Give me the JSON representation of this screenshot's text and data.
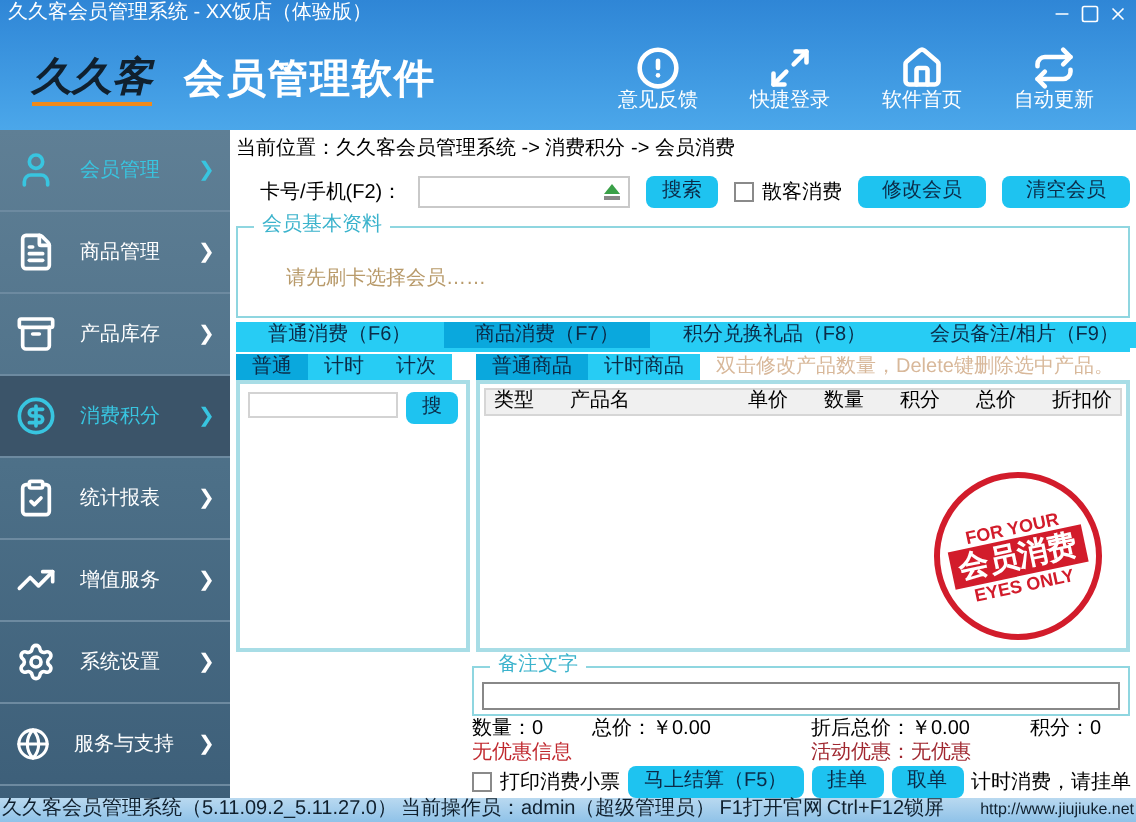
{
  "window": {
    "title": "久久客会员管理系统 - XX饭店（体验版）"
  },
  "header": {
    "logo": "久久客",
    "app_name": "会员管理软件",
    "actions": [
      {
        "kind": "feedback",
        "label": "意见反馈"
      },
      {
        "kind": "switch",
        "label": "快捷登录"
      },
      {
        "kind": "home",
        "label": "软件首页"
      },
      {
        "kind": "update",
        "label": "自动更新"
      }
    ]
  },
  "sidebar": {
    "items": [
      {
        "kind": "member",
        "label": "会员管理",
        "selected": false,
        "highlighted": true
      },
      {
        "kind": "goods",
        "label": "商品管理",
        "selected": false,
        "highlighted": false
      },
      {
        "kind": "stock",
        "label": "产品库存",
        "selected": false,
        "highlighted": false
      },
      {
        "kind": "money",
        "label": "消费积分",
        "selected": true,
        "highlighted": true
      },
      {
        "kind": "report",
        "label": "统计报表",
        "selected": false,
        "highlighted": false
      },
      {
        "kind": "chart",
        "label": "增值服务",
        "selected": false,
        "highlighted": false
      },
      {
        "kind": "settings",
        "label": "系统设置",
        "selected": false,
        "highlighted": false
      },
      {
        "kind": "globe",
        "label": "服务与支持",
        "selected": false,
        "highlighted": false
      }
    ],
    "chevron": "❯"
  },
  "breadcrumb": "当前位置：久久客会员管理系统 -> 消费积分 -> 会员消费",
  "card_search": {
    "label": "卡号/手机(F2)：",
    "search_button": "搜索",
    "walk_in": {
      "label": "散客消费",
      "checked": false
    },
    "buttons": [
      "修改会员",
      "清空会员"
    ]
  },
  "member_info": {
    "legend": "会员基本资料",
    "hint": "请先刷卡选择会员……"
  },
  "tabs": [
    {
      "label": "普通消费（F6）",
      "selected": false
    },
    {
      "label": "商品消费（F7）",
      "selected": true
    },
    {
      "label": "积分兑换礼品（F8）",
      "selected": false
    },
    {
      "label": "会员备注/相片（F9）",
      "selected": false
    }
  ],
  "left_panel": {
    "tabs": [
      {
        "label": "普通",
        "selected": true
      },
      {
        "label": "计时",
        "selected": false
      },
      {
        "label": "计次",
        "selected": false
      }
    ],
    "search_button": "搜"
  },
  "right_panel": {
    "tabs": [
      {
        "label": "普通商品",
        "selected": true
      },
      {
        "label": "计时商品",
        "selected": false
      }
    ],
    "hint": "双击修改产品数量，Delete键删除选中产品。",
    "columns": [
      "类型",
      "产品名",
      "单价",
      "数量",
      "积分",
      "总价",
      "折扣价"
    ]
  },
  "stamp": {
    "top": "FOR YOUR",
    "main": "会员消费",
    "bottom": "EYES ONLY"
  },
  "notes": {
    "legend": "备注文字"
  },
  "summary": {
    "quantity": "数量：0",
    "total": "总价：￥0.00",
    "discounted": "折后总价：￥0.00",
    "points": "积分：0",
    "discount_info": "无优惠信息",
    "promotion": "活动优惠：无优惠"
  },
  "actions": {
    "print_receipt": {
      "label": "打印消费小票",
      "checked": false
    },
    "checkout": "马上结算（F5）",
    "hold": "挂单",
    "retrieve": "取单",
    "note": "计时消费，请挂单"
  },
  "status_bar": {
    "version": "久久客会员管理系统（5.11.09.2_5.11.27.0）",
    "operator": "当前操作员：admin（超级管理员）",
    "website_key": "F1打开官网",
    "lock_key": "Ctrl+F12锁屏",
    "url": "http://www.jiujiuke.net"
  }
}
